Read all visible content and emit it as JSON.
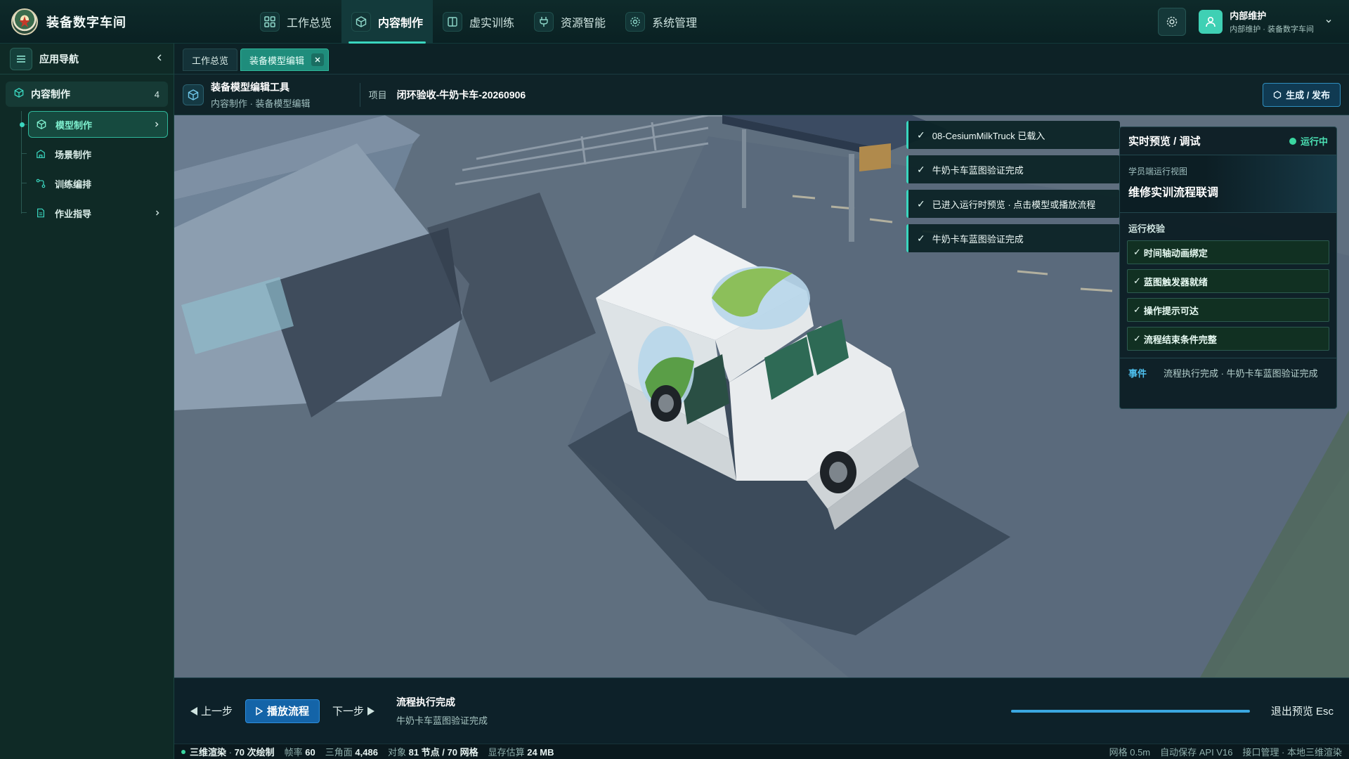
{
  "app": {
    "title": "装备数字车间"
  },
  "topnav": [
    {
      "label": "工作总览",
      "icon": "grid-icon",
      "active": false
    },
    {
      "label": "内容制作",
      "icon": "cube-icon",
      "active": true
    },
    {
      "label": "虚实训练",
      "icon": "book-icon",
      "active": false
    },
    {
      "label": "资源智能",
      "icon": "plug-icon",
      "active": false
    },
    {
      "label": "系统管理",
      "icon": "gear-icon",
      "active": false
    }
  ],
  "user": {
    "name": "内部维护",
    "subtitle": "内部维护 · 装备数字车间"
  },
  "sidebar": {
    "title": "应用导航",
    "group": {
      "label": "内容制作",
      "count": "4"
    },
    "items": [
      {
        "label": "模型制作",
        "active": true
      },
      {
        "label": "场景制作",
        "active": false
      },
      {
        "label": "训练编排",
        "active": false
      },
      {
        "label": "作业指导",
        "active": false
      }
    ]
  },
  "tabs": [
    {
      "label": "工作总览",
      "active": false
    },
    {
      "label": "装备模型编辑",
      "active": true
    }
  ],
  "toolbar": {
    "title": "装备模型编辑工具",
    "breadcrumb": "内容制作 · 装备模型编辑",
    "project_label": "项目",
    "project_value": "闭环验收-牛奶卡车-20260906",
    "publish_label": "生成 / 发布"
  },
  "logs": [
    "08-CesiumMilkTruck 已载入",
    "牛奶卡车蓝图验证完成",
    "已进入运行时预览 · 点击模型或播放流程",
    "牛奶卡车蓝图验证完成"
  ],
  "preview": {
    "title": "实时预览 / 调试",
    "status": "运行中",
    "view_sub": "学员端运行视图",
    "view_title": "维修实训流程联调",
    "checks_title": "运行校验",
    "checks": [
      "时间轴动画绑定",
      "蓝图触发器就绪",
      "操作提示可达",
      "流程结束条件完整"
    ],
    "event_label": "事件",
    "event_text": "流程执行完成 · 牛奶卡车蓝图验证完成"
  },
  "playback": {
    "prev_label": "上一步",
    "play_label": "播放流程",
    "next_label": "下一步",
    "info_title": "流程执行完成",
    "info_sub": "牛奶卡车蓝图验证完成",
    "progress": 1.0,
    "exit_label": "退出预览 Esc"
  },
  "status": {
    "render": "三维渲染",
    "draws": "70 次绘制",
    "fps_label": "帧率",
    "fps": "60",
    "tri_label": "三角面",
    "tri": "4,486",
    "obj_label": "对象",
    "obj": "81 节点 / 70 网格",
    "mem_label": "显存估算",
    "mem": "24 MB",
    "grid": "网格 0.5m",
    "autosave": "自动保存 API V16",
    "api": "接口管理 · 本地三维渲染"
  },
  "colors": {
    "accent": "#3ad6bf",
    "running": "#3ad6a0",
    "play_button": "#1464a8",
    "progress": "#3aa7e0"
  }
}
